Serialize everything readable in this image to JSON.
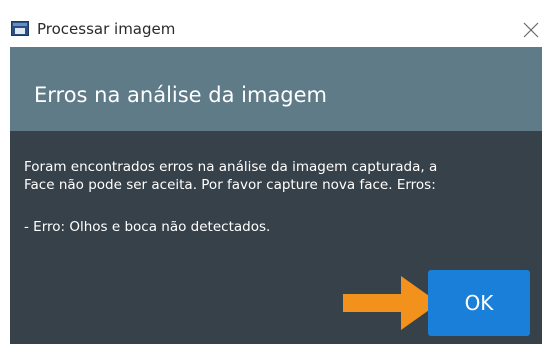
{
  "window": {
    "title": "Processar imagem",
    "icon": "app-window-icon",
    "close_icon": "close-icon"
  },
  "dialog": {
    "title": "Erros na análise da imagem",
    "message_line1": "Foram encontrados erros na análise da imagem capturada, a",
    "message_line2": "Face não pode ser aceita. Por favor capture nova face. Erros:",
    "error_line": "- Erro: Olhos e boca não detectados.",
    "ok_label": "OK"
  },
  "annotation": {
    "arrow_icon": "arrow-right-icon",
    "arrow_color": "#f3911d"
  },
  "colors": {
    "dialog_background": "#36414a",
    "header_background": "#5e7b87",
    "ok_button": "#1a7fd8"
  }
}
